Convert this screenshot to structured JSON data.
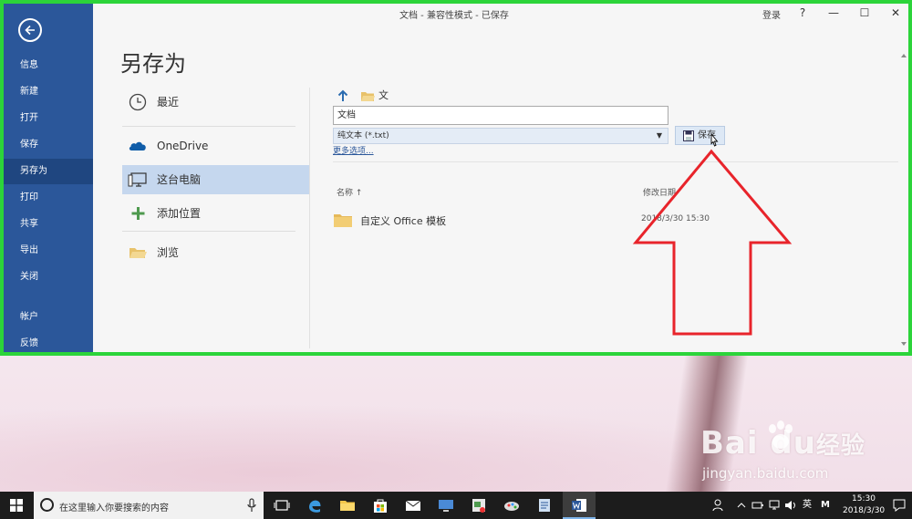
{
  "window": {
    "title": "文档  -  兼容性模式  -  已保存",
    "login": "登录",
    "help": "?",
    "minimize": "—",
    "maximize": "☐",
    "close": "✕"
  },
  "backstage": {
    "items": [
      {
        "label": "信息"
      },
      {
        "label": "新建"
      },
      {
        "label": "打开"
      },
      {
        "label": "保存"
      },
      {
        "label": "另存为",
        "active": true
      },
      {
        "label": "打印"
      },
      {
        "label": "共享"
      },
      {
        "label": "导出"
      },
      {
        "label": "关闭"
      },
      {
        "label": "帐户"
      },
      {
        "label": "反馈"
      }
    ]
  },
  "saveas": {
    "heading": "另存为",
    "places": [
      {
        "label": "最近",
        "icon": "clock-icon"
      },
      {
        "label": "OneDrive",
        "icon": "cloud-icon"
      },
      {
        "label": "这台电脑",
        "icon": "computer-icon",
        "active": true
      },
      {
        "label": "添加位置",
        "icon": "plus-icon"
      },
      {
        "label": "浏览",
        "icon": "folder-open-icon"
      }
    ],
    "path": "文档",
    "filename": "文档",
    "filetype": "纯文本 (*.txt)",
    "more_options": "更多选项...",
    "save_label": "保存",
    "columns": {
      "name": "名称 ↑",
      "date": "修改日期"
    },
    "files": [
      {
        "name": "自定义 Office 模板",
        "date": "2018/3/30 15:30"
      }
    ]
  },
  "colors": {
    "accent": "#2b579a",
    "highlight": "#c5d7ee",
    "frame": "#2cd43a",
    "annotation": "#e8242b"
  },
  "taskbar": {
    "search_placeholder": "在这里输入你要搜索的内容",
    "ime": "英",
    "ime2": "M",
    "time": "15:30",
    "date": "2018/3/30"
  },
  "watermark": {
    "logo": "Bai  du",
    "logo_suffix": "经验",
    "sub": "jingyan.baidu.com"
  }
}
